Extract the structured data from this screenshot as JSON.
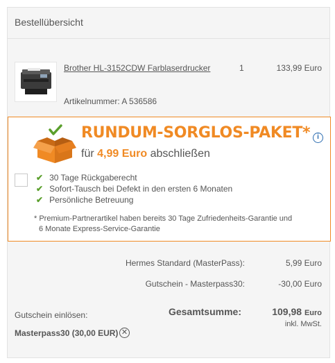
{
  "header": {
    "title": "Bestellübersicht"
  },
  "product": {
    "name": "Brother HL-3152CDW Farblaserdrucker",
    "quantity": "1",
    "price": "133,99 Euro",
    "article_number": "Artikelnummer: A 536586"
  },
  "promo": {
    "title": "RUNDUM-SORGLOS-PAKET*",
    "subtitle_prefix": "für",
    "subtitle_price": "4,99 Euro",
    "subtitle_suffix": "abschließen",
    "benefits": [
      "30 Tage Rückgaberecht",
      "Sofort-Tausch bei Defekt in den ersten 6 Monaten",
      "Persönliche Betreuung"
    ],
    "footnote_line1": "* Premium-Partnerartikel haben bereits 30 Tage Zufriedenheits-Garantie und",
    "footnote_line2": "6 Monate Express-Service-Garantie",
    "accent_color": "#f08a24",
    "icons": [
      "orange-box-icon",
      "info-icon",
      "checkmark-icon"
    ]
  },
  "summary": {
    "shipping_label": "Hermes Standard (MasterPass):",
    "shipping_value": "5,99 Euro",
    "voucher_label": "Gutschein - Masterpass30:",
    "voucher_value": "-30,00 Euro",
    "total_label": "Gesamtsumme:",
    "total_value": "109,98",
    "total_currency": "Euro",
    "vat_note": "inkl. MwSt."
  },
  "voucher": {
    "redeem_label": "Gutschein einlösen:",
    "code": "Masterpass30 (30,00 EUR)",
    "remove_symbol": "✕"
  }
}
